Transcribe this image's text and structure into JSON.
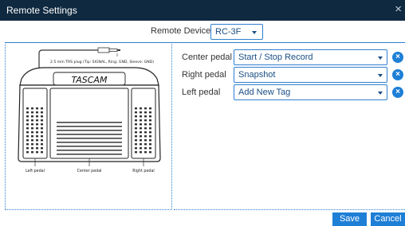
{
  "window": {
    "title": "Remote Settings",
    "close_glyph": "×"
  },
  "device": {
    "label": "Remote Device:",
    "selected": "RC-3F"
  },
  "illustration": {
    "plug_caption": "2.5 mm TRS plug (Tip: SIGNAL, Ring: GND, Sleeve: GND)",
    "brand": "TASCAM",
    "left_caption": "Left pedal",
    "center_caption": "Center pedal",
    "right_caption": "Right pedal"
  },
  "assignments": [
    {
      "label": "Center pedal",
      "value": "Start / Stop Record",
      "clear_glyph": "×"
    },
    {
      "label": "Right pedal",
      "value": "Snapshot",
      "clear_glyph": "×"
    },
    {
      "label": "Left pedal",
      "value": "Add New Tag",
      "clear_glyph": "×"
    }
  ],
  "buttons": {
    "save": "Save",
    "cancel": "Cancel"
  },
  "colors": {
    "titlebar": "#0f2940",
    "accent": "#1e7fd6",
    "select_border": "#2f7fd1"
  }
}
